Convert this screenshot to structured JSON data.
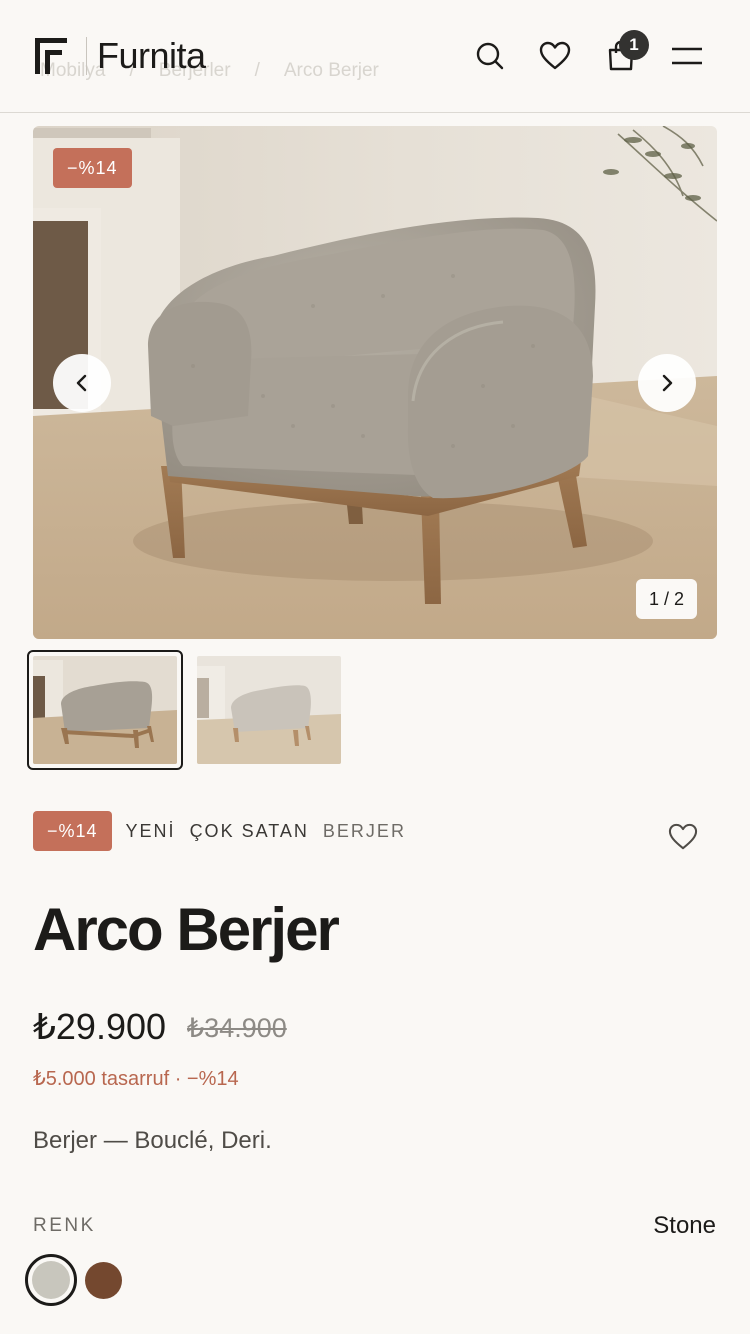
{
  "header": {
    "brand": "Furnita",
    "cart_count": "1",
    "breadcrumb": [
      "Mobilya",
      "/",
      "Berjerler",
      "/",
      "Arco Berjer"
    ]
  },
  "gallery": {
    "discount_badge": "−%14",
    "counter": "1 / 2",
    "thumbnails": [
      "thumb-1",
      "thumb-2"
    ],
    "active_index": 1
  },
  "product": {
    "tags": {
      "sale": "−%14",
      "new": "YENİ",
      "bestseller": "ÇOK SATAN",
      "category": "BERJER"
    },
    "title": "Arco Berjer",
    "price": "₺29.900",
    "old_price": "₺34.900",
    "savings": "₺5.000 tasarruf · −%14",
    "description": "Berjer — Bouclé, Deri.",
    "color_label": "RENK",
    "color_value": "Stone",
    "swatches": [
      {
        "name": "Stone",
        "hex": "#c8c6bd"
      },
      {
        "name": "Brown",
        "hex": "#74482f"
      }
    ]
  },
  "colors": {
    "accent": "#c4705a",
    "savings_text": "#b8674f",
    "background": "#faf8f5"
  }
}
